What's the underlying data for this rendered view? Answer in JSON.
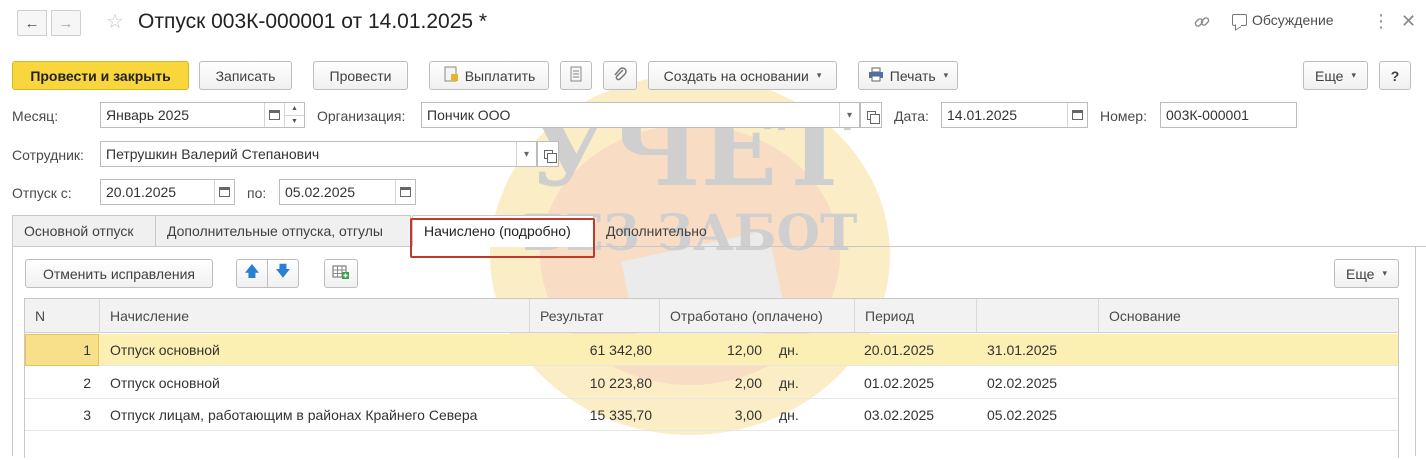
{
  "window": {
    "title": "Отпуск 003К-000001 от 14.01.2025 *",
    "discussion_label": "Обсуждение"
  },
  "toolbar": {
    "post_and_close": "Провести и закрыть",
    "save": "Записать",
    "post": "Провести",
    "pay": "Выплатить",
    "create_based_on": "Создать на основании",
    "print": "Печать",
    "more": "Еще",
    "help": "?"
  },
  "form": {
    "month_label": "Месяц:",
    "month_value": "Январь 2025",
    "org_label": "Организация:",
    "org_value": "Пончик ООО",
    "date_label": "Дата:",
    "date_value": "14.01.2025",
    "number_label": "Номер:",
    "number_value": "003К-000001",
    "employee_label": "Сотрудник:",
    "employee_value": "Петрушкин Валерий Степанович",
    "vacation_from_label": "Отпуск с:",
    "vacation_from_value": "20.01.2025",
    "vacation_to_label": "по:",
    "vacation_to_value": "05.02.2025"
  },
  "tabs": [
    {
      "label": "Основной отпуск"
    },
    {
      "label": "Дополнительные отпуска, отгулы"
    },
    {
      "label": "Начислено (подробно)"
    },
    {
      "label": "Дополнительно"
    }
  ],
  "panel": {
    "cancel_corrections": "Отменить исправления",
    "more": "Еще"
  },
  "table": {
    "columns": [
      "N",
      "Начисление",
      "Результат",
      "Отработано (оплачено)",
      "Период",
      "",
      "Основание"
    ],
    "rows": [
      {
        "n": "1",
        "accrual": "Отпуск основной",
        "result": "61 342,80",
        "worked": "12,00",
        "unit": "дн.",
        "from": "20.01.2025",
        "to": "31.01.2025",
        "basis": ""
      },
      {
        "n": "2",
        "accrual": "Отпуск основной",
        "result": "10 223,80",
        "worked": "2,00",
        "unit": "дн.",
        "from": "01.02.2025",
        "to": "02.02.2025",
        "basis": ""
      },
      {
        "n": "3",
        "accrual": "Отпуск лицам, работающим в районах Крайнего Севера",
        "result": "15 335,70",
        "worked": "3,00",
        "unit": "дн.",
        "from": "03.02.2025",
        "to": "05.02.2025",
        "basis": ""
      }
    ]
  },
  "watermark": {
    "line1": "УЧЕТ",
    "line2": "БЕЗ ЗАБОТ"
  },
  "colors": {
    "primary_button": "#f9d73c",
    "selected_row": "#fbefb3",
    "tab_highlight": "#c0392b",
    "arrow_blue": "#2b7fd2"
  }
}
